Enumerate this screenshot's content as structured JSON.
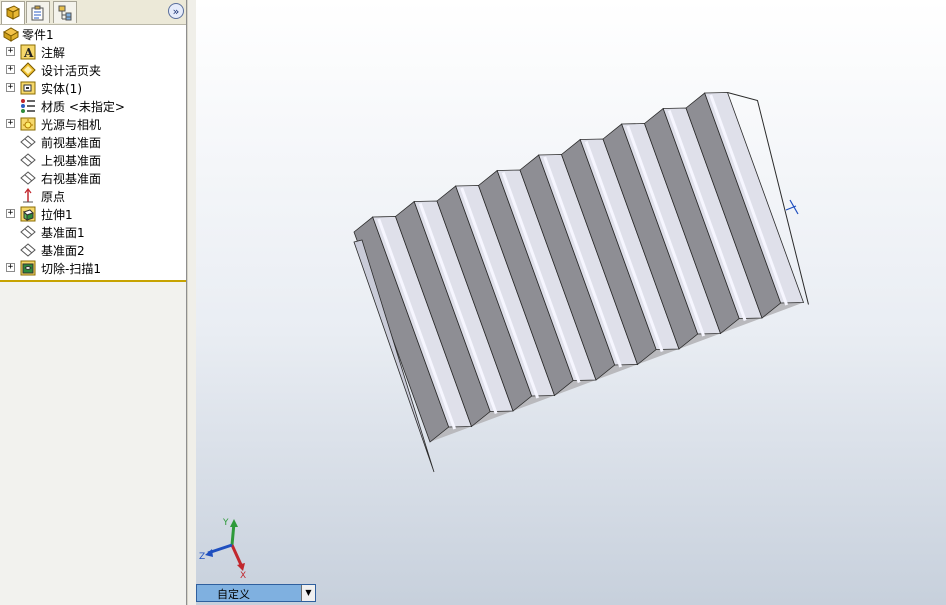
{
  "panel": {
    "tabs": [
      {
        "name": "feature-manager"
      },
      {
        "name": "property-manager"
      },
      {
        "name": "configuration-manager"
      }
    ],
    "expand_glyph": "»"
  },
  "tree": {
    "root": {
      "label": "零件1",
      "icon": "part-icon"
    },
    "items": [
      {
        "label": "注解",
        "icon": "annotation-icon",
        "expandable": true
      },
      {
        "label": "设计活页夹",
        "icon": "design-binder-icon",
        "expandable": true
      },
      {
        "label": "实体(1)",
        "icon": "solid-bodies-icon",
        "expandable": true
      },
      {
        "label": "材质 <未指定>",
        "icon": "material-icon",
        "expandable": false
      },
      {
        "label": "光源与相机",
        "icon": "lights-cameras-icon",
        "expandable": true
      },
      {
        "label": "前视基准面",
        "icon": "plane-icon",
        "expandable": false
      },
      {
        "label": "上视基准面",
        "icon": "plane-icon",
        "expandable": false
      },
      {
        "label": "右视基准面",
        "icon": "plane-icon",
        "expandable": false
      },
      {
        "label": "原点",
        "icon": "origin-icon",
        "expandable": false
      },
      {
        "label": "拉伸1",
        "icon": "extrude-icon",
        "expandable": true
      },
      {
        "label": "基准面1",
        "icon": "plane-icon",
        "expandable": false
      },
      {
        "label": "基准面2",
        "icon": "plane-icon",
        "expandable": false
      },
      {
        "label": "切除-扫描1",
        "icon": "cut-sweep-icon",
        "expandable": true
      }
    ]
  },
  "view": {
    "orientation_select": "自定义",
    "triad": {
      "x": "X",
      "y": "Y",
      "z": "Z"
    }
  },
  "colors": {
    "panel_separator": "#c7a300",
    "view_select_bg": "#7fb0e0"
  }
}
